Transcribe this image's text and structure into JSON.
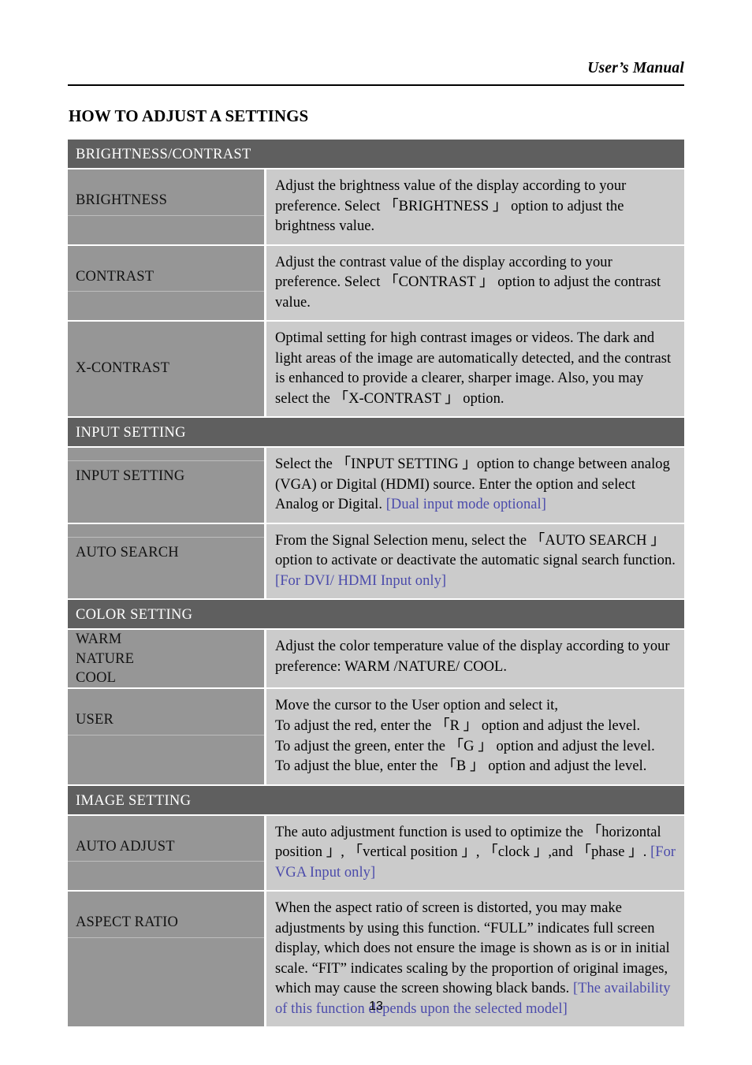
{
  "header": {
    "running_title": "User’s Manual",
    "page_title": "HOW TO ADJUST A SETTINGS"
  },
  "footer": {
    "page_number": "13"
  },
  "colors": {
    "band_background": "#5f5f5f",
    "label_cell_background": "#969696",
    "description_cell_background": "#cbcbcb",
    "note_text": "#4b4bab",
    "page_background": "#ffffff",
    "rule": "#000000"
  },
  "sections": [
    {
      "band": "BRIGHTNESS/CONTRAST",
      "rows": [
        {
          "label": "BRIGHTNESS",
          "divider": "below",
          "description": "Adjust the brightness value of the display according to your preference. Select 「BRIGHTNESS 」 option to adjust the brightness value.",
          "note": ""
        },
        {
          "label": "CONTRAST",
          "divider": "below",
          "description": "Adjust the contrast value of the display according to your preference. Select 「CONTRAST 」 option to adjust the contrast value.",
          "note": ""
        },
        {
          "label": "X-CONTRAST",
          "divider": "none",
          "description": "Optimal setting for high contrast images or videos. The dark and light areas of the image are automatically detected, and the contrast is enhanced to provide a clearer, sharper image. Also, you may select the 「X-CONTRAST 」 option.",
          "note": ""
        }
      ]
    },
    {
      "band": "INPUT SETTING",
      "rows": [
        {
          "label": "INPUT SETTING",
          "divider": "above",
          "description": "Select the 「INPUT SETTING 」option to change between analog (VGA) or Digital (HDMI) source. Enter the option and select Analog or Digital. ",
          "note": "[Dual input mode optional]"
        },
        {
          "label": "AUTO SEARCH",
          "divider": "above",
          "description": "From the Signal Selection menu, select the 「AUTO SEARCH 」 option to activate or deactivate the automatic signal search function. ",
          "note": "[For DVI/ HDMI Input only]"
        }
      ]
    },
    {
      "band": "COLOR SETTING",
      "rows": [
        {
          "label": "WARM\nNATURE\nCOOL",
          "divider": "multiline",
          "description": "Adjust the color temperature value of the display according to your preference: WARM /NATURE/ COOL.",
          "note": ""
        },
        {
          "label": "USER",
          "divider": "below",
          "description": "Move the cursor to the User option and select it,\nTo adjust the red, enter the 「R 」 option and adjust the level.\nTo adjust the green, enter the 「G 」 option and adjust the level.\nTo adjust the blue, enter the 「B 」 option and adjust the level.",
          "note": ""
        }
      ]
    },
    {
      "band": "IMAGE SETTING",
      "rows": [
        {
          "label": "AUTO ADJUST",
          "divider": "below",
          "description": "The auto adjustment function is used to optimize the 「horizontal position 」, 「vertical position 」, 「clock 」,and 「phase 」. ",
          "note": "[For VGA Input only]"
        },
        {
          "label": "ASPECT RATIO",
          "divider": "below",
          "description": "When the aspect ratio of screen is distorted, you may make adjustments by using this function. “FULL” indicates full screen display, which does not ensure the image is shown as is or in initial scale. “FIT” indicates scaling by the proportion of original images, which may cause the screen showing black bands. ",
          "note": "[The availability of this function depends upon the selected model]"
        }
      ]
    }
  ]
}
